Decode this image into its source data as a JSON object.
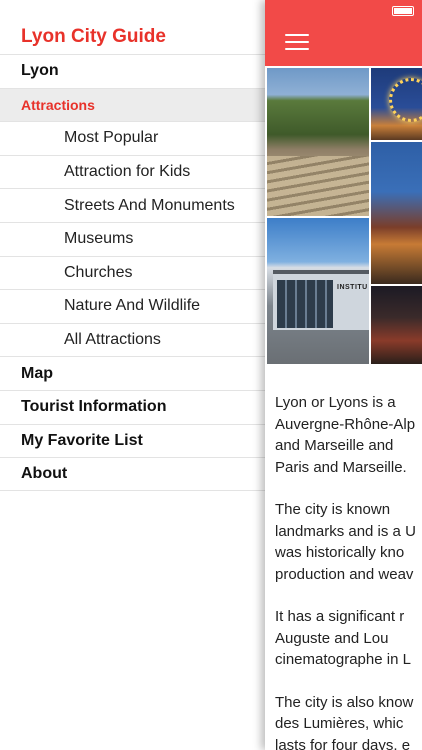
{
  "menu": {
    "app_title": "Lyon City Guide",
    "items": [
      {
        "label": "Lyon",
        "type": "top"
      },
      {
        "label": "Attractions",
        "type": "section"
      },
      {
        "label": "Most Popular",
        "type": "sub"
      },
      {
        "label": "Attraction for Kids",
        "type": "sub"
      },
      {
        "label": "Streets And Monuments",
        "type": "sub"
      },
      {
        "label": "Museums",
        "type": "sub"
      },
      {
        "label": "Churches",
        "type": "sub"
      },
      {
        "label": "Nature And Wildlife",
        "type": "sub"
      },
      {
        "label": "All Attractions",
        "type": "sub"
      },
      {
        "label": "Map",
        "type": "top"
      },
      {
        "label": "Tourist Information",
        "type": "top"
      },
      {
        "label": "My Favorite List",
        "type": "top"
      },
      {
        "label": "About",
        "type": "top"
      }
    ]
  },
  "main": {
    "photo_sign": "INSTITU",
    "paragraphs": [
      [
        "Lyon or Lyons is a",
        "Auvergne-Rhône-Alp",
        "and Marseille and",
        "Paris and Marseille."
      ],
      [
        "The city is known",
        "landmarks and is a U",
        "was historically kno",
        "production and weav"
      ],
      [
        "It has a significant r",
        "Auguste and Lou",
        "cinematographe in L"
      ],
      [
        "The city is also know",
        "des Lumières, whic",
        "lasts for four days, e"
      ]
    ]
  },
  "colors": {
    "accent": "#e8322a",
    "navbar": "#f24a48",
    "section_bg": "#ececec"
  },
  "icons": {
    "menu": "hamburger-icon",
    "battery": "battery-icon"
  }
}
